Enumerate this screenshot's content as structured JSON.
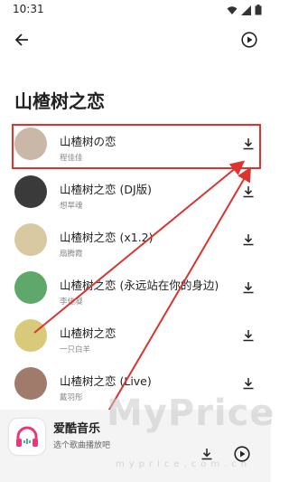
{
  "status_bar": {
    "time": "10:31"
  },
  "header": {
    "title": "山楂树之恋"
  },
  "songs": [
    {
      "title": "山楂树の恋",
      "artist": "程佳佳",
      "avatar_color": "#c9b8a8"
    },
    {
      "title": "山楂树之恋 (DJ版)",
      "artist": "想旱魂",
      "avatar_color": "#3a3a3a"
    },
    {
      "title": "山楂树之恋 (x1.2)",
      "artist": "扇腾霞",
      "avatar_color": "#d8c9a0"
    },
    {
      "title": "山楂树之恋 (永远站在你的身边)",
      "artist": "李佳凝",
      "avatar_color": "#5fa86b"
    },
    {
      "title": "山楂树之恋",
      "artist": "一只白羊",
      "avatar_color": "#d9c97a"
    },
    {
      "title": "山楂树之恋 (Live)",
      "artist": "戴羽彤",
      "avatar_color": "#a07a6a"
    }
  ],
  "bottom_bar": {
    "app_name": "爱酷音乐",
    "subtitle": "选个歌曲播放吧"
  },
  "colors": {
    "highlight": "#d9342f",
    "accent": "#e8387a"
  },
  "watermark": {
    "main": "MyPrice",
    "sub": "myprice.com.cn"
  }
}
